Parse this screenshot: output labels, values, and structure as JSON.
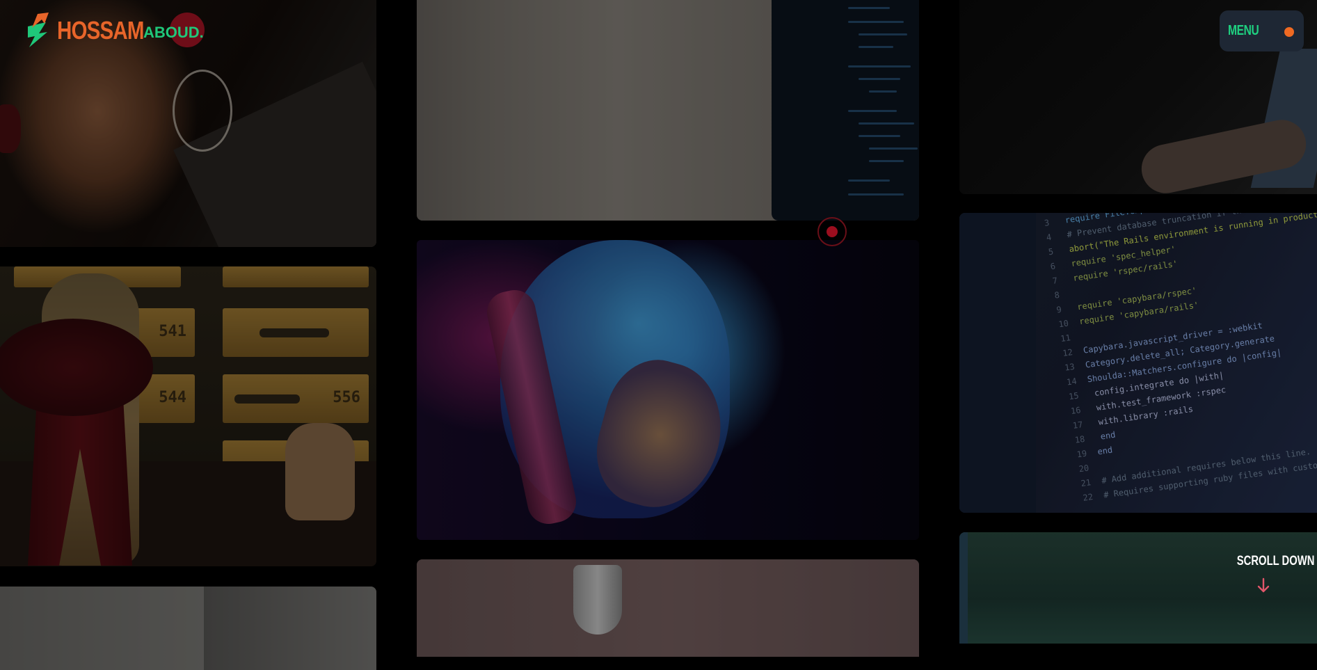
{
  "brand": {
    "name_main": "HOSSAM",
    "name_sub": "ABOUD.",
    "colors": {
      "primary": "#e8652a",
      "accent": "#1fc87a"
    }
  },
  "nav": {
    "menu_label": "MENU",
    "menu_dot_color": "#f06a22"
  },
  "scroll": {
    "label": "SCROLL DOWN",
    "icon": "arrow-down-icon",
    "arrow_color": "#e0566a"
  },
  "gallery": {
    "tiles": [
      {
        "name": "woman-hoop-earring-photo"
      },
      {
        "name": "girl-bow-lockers-photo"
      },
      {
        "name": "office-shelf-photo"
      },
      {
        "name": "monitor-code-photo"
      },
      {
        "name": "astronaut-helmet-photo"
      },
      {
        "name": "pendant-lamp-photo"
      },
      {
        "name": "laptop-hand-photo"
      },
      {
        "name": "ruby-code-editor-photo"
      },
      {
        "name": "green-blur-photo"
      }
    ],
    "code_tile": {
      "line_numbers": [
        "3",
        "4",
        "5",
        "6",
        "7",
        "8",
        "9",
        "10",
        "11",
        "12",
        "13",
        "14",
        "15",
        "16",
        "17",
        "18",
        "19",
        "20",
        "21",
        "22"
      ],
      "lines": [
        "require File.expand_path('../../config/environment', __FILE__)",
        "# Prevent database truncation if the environment is production",
        "abort(\"The Rails environment is running in production mode!\")",
        "require 'spec_helper'",
        "require 'rspec/rails'",
        "",
        "require 'capybara/rspec'",
        "require 'capybara/rails'",
        "",
        "Capybara.javascript_driver = :webkit",
        "Category.delete_all; Category.generate",
        "Shoulda::Matchers.configure do |config|",
        "  config.integrate do |with|",
        "    with.test_framework :rspec",
        "    with.library :rails",
        "  end",
        "end",
        "",
        "# Add additional requires below this line.",
        "# Requires supporting ruby files with custom matchers"
      ],
      "locker_numbers": [
        "541",
        "544",
        "556"
      ]
    }
  }
}
